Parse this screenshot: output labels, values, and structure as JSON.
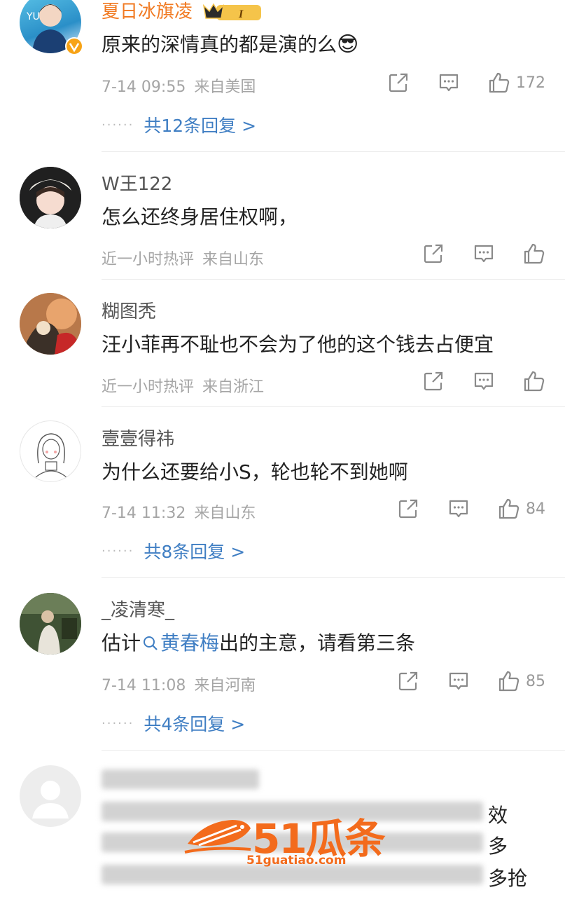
{
  "comments": [
    {
      "username": "夏日冰旗凌",
      "badge": "I",
      "text": "原来的深情真的都是演的么",
      "emoji": "😎",
      "time": "7-14 09:55",
      "location": "来自美国",
      "likes": "172",
      "replies": "共12条回复 >"
    },
    {
      "username": "W王122",
      "text": "怎么还终身居住权啊，",
      "time": "近一小时热评",
      "location": "来自山东",
      "likes": ""
    },
    {
      "username": "糊图秃",
      "text": "汪小菲再不耻也不会为了他的这个钱去占便宜",
      "time": "近一小时热评",
      "location": "来自浙江",
      "likes": ""
    },
    {
      "username": "壹壹得祎",
      "text": "为什么还要给小S，轮也轮不到她啊",
      "time": "7-14 11:32",
      "location": "来自山东",
      "likes": "84",
      "replies": "共8条回复 >"
    },
    {
      "username": "_凌清寒_",
      "text_before": "估计",
      "search_link": "黄春梅",
      "text_after": "出的主意，请看第三条",
      "time": "7-14 11:08",
      "location": "来自河南",
      "likes": "85",
      "replies": "共4条回复 >"
    }
  ],
  "partial_comment": {
    "visible_tails": [
      "效",
      "多",
      "多抢"
    ]
  },
  "watermark": {
    "text": "51瓜条",
    "url": "51guatiao.com"
  },
  "colors": {
    "link": "#3f7ec3",
    "vip_name": "#f17a22",
    "meta": "#a5a5a5",
    "watermark": "#f36b1c"
  }
}
